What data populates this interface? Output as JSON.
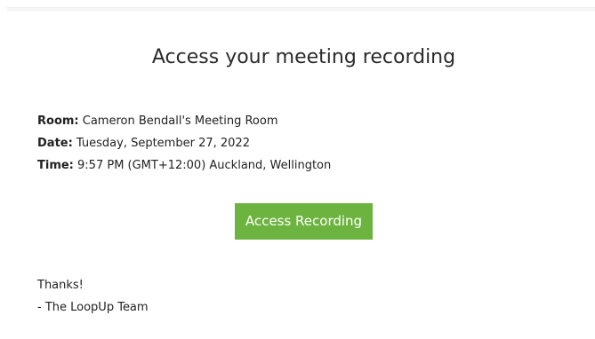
{
  "email": {
    "heading": "Access your meeting recording",
    "details": {
      "room_label": "Room:",
      "room_value": " Cameron Bendall's Meeting Room",
      "date_label": "Date:",
      "date_value": " Tuesday, September 27, 2022",
      "time_label": "Time:",
      "time_value": " 9:57 PM (GMT+12:00) Auckland, Wellington"
    },
    "button_label": "Access Recording",
    "thanks": "Thanks!",
    "signature": "- The LoopUp Team"
  },
  "colors": {
    "button_bg": "#6db33f",
    "button_text": "#ffffff",
    "heading_text": "#2b2b2b"
  }
}
